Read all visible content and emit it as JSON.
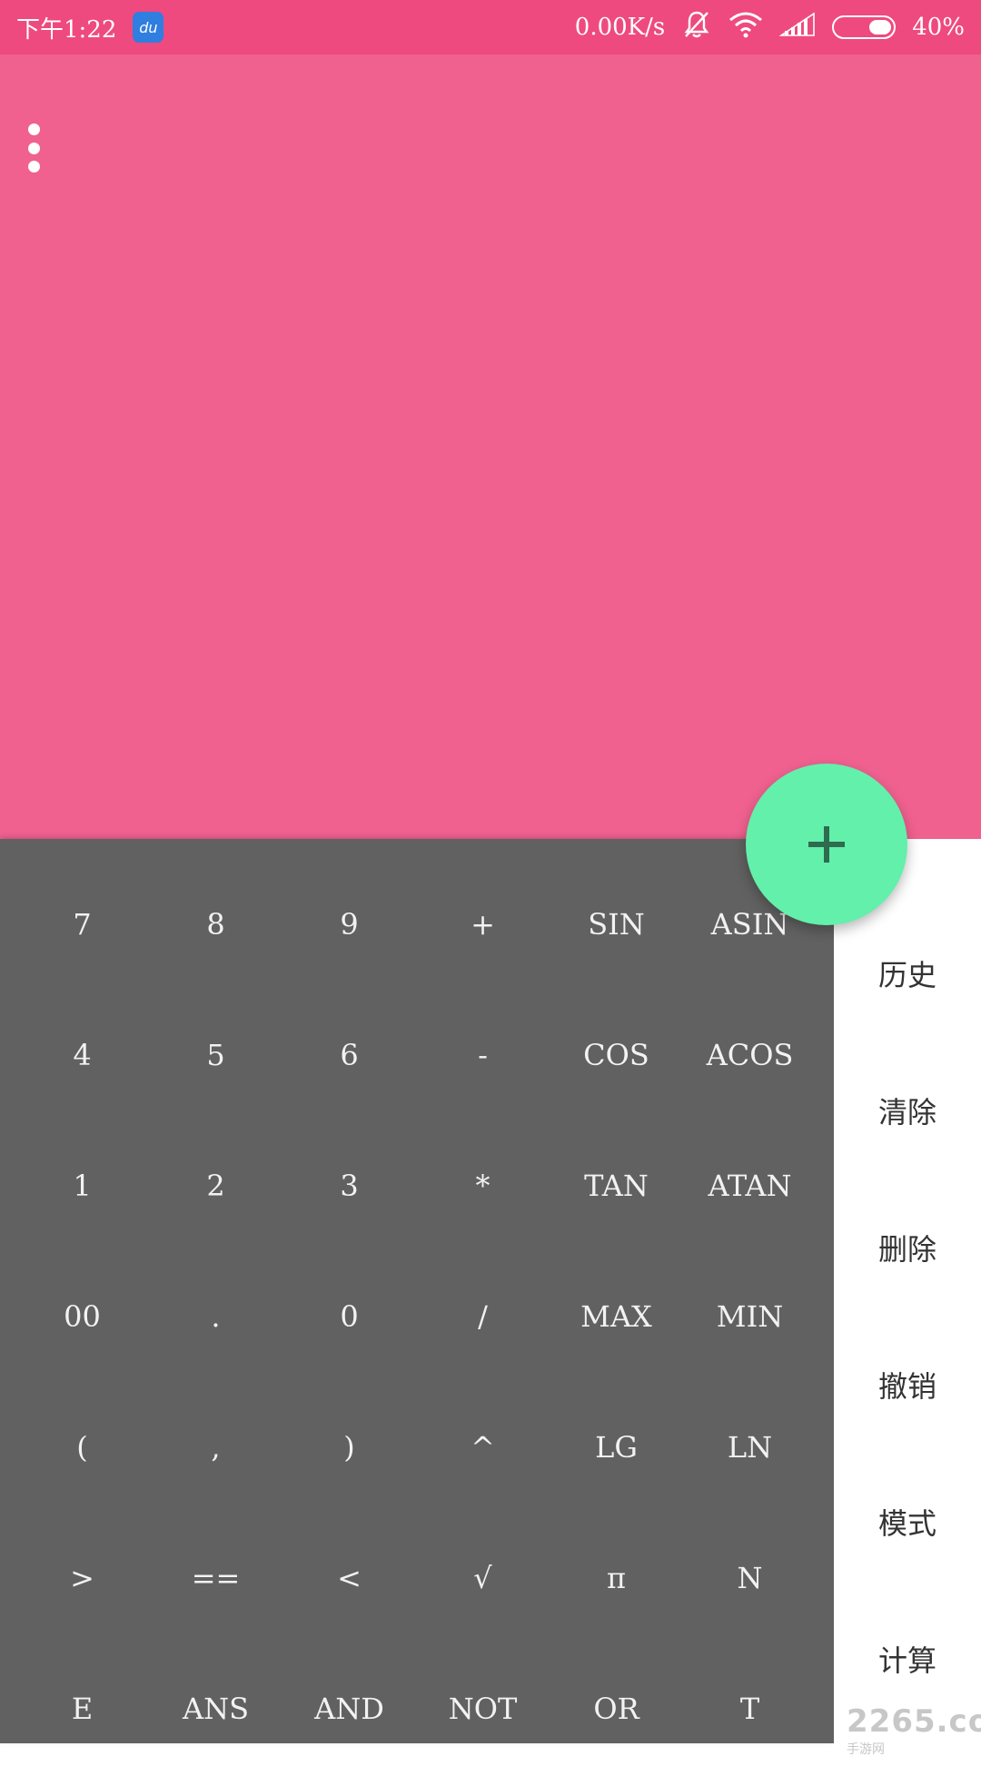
{
  "status_bar": {
    "time": "下午1:22",
    "app_badge": "du",
    "network_speed": "0.00K/s",
    "battery_level": "40%",
    "battery_fraction": 0.4,
    "icons": [
      "mute-bell-icon",
      "wifi-icon",
      "signal-icon",
      "battery-icon"
    ]
  },
  "display": {
    "menu_icon": "more-vertical-icon",
    "background_color": "#f06190"
  },
  "fab": {
    "label": "+",
    "color": "#62f0ab"
  },
  "keypad": {
    "rows": [
      [
        "7",
        "8",
        "9",
        "+",
        "SIN",
        "ASIN"
      ],
      [
        "4",
        "5",
        "6",
        "-",
        "COS",
        "ACOS"
      ],
      [
        "1",
        "2",
        "3",
        "*",
        "TAN",
        "ATAN"
      ],
      [
        "00",
        ".",
        "0",
        "/",
        "MAX",
        "MIN"
      ],
      [
        "(",
        ",",
        ")",
        "^",
        "LG",
        "LN"
      ],
      [
        ">",
        "==",
        "<",
        "√",
        "π",
        "N"
      ],
      [
        "E",
        "ANS",
        "AND",
        "NOT",
        "OR",
        "T"
      ]
    ]
  },
  "side_panel": {
    "items": [
      "历史",
      "清除",
      "删除",
      "撤销",
      "模式",
      "计算"
    ]
  },
  "watermark": {
    "brand": "2265",
    "suffix": ".com",
    "subtitle": "手游网"
  },
  "colors": {
    "status_bar": "#ee4a7f",
    "keypad_bg": "#616161",
    "key_text": "#f2f2f2",
    "side_text": "#333333"
  }
}
